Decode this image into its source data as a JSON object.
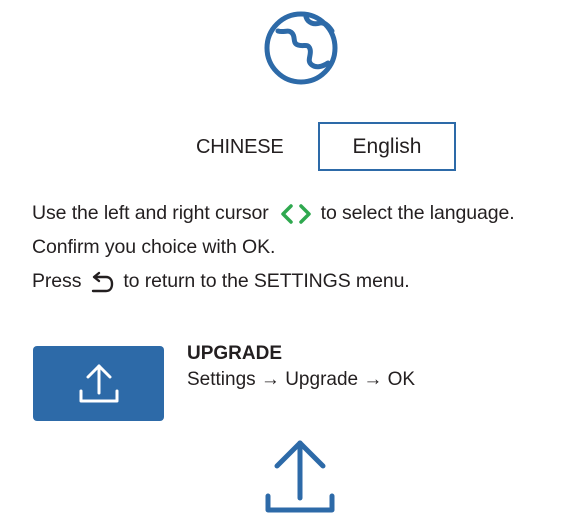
{
  "icons": {
    "globe": "globe-icon",
    "cursor": "left-right-cursor-icon",
    "return": "return-arrow-icon",
    "upgrade": "upload-icon",
    "upload_large": "upload-icon"
  },
  "colors": {
    "accent": "#2d6aa8",
    "cursor_green": "#2fa84f",
    "text": "#231f20"
  },
  "language": {
    "options": [
      "CHINESE",
      "English"
    ],
    "selected": "English"
  },
  "instructions": {
    "line1_before": "Use the left and right cursor",
    "line1_after": "to select the language.",
    "line2": "Confirm you choice with OK.",
    "line3_before": "Press",
    "line3_after": "to return to the SETTINGS menu."
  },
  "upgrade": {
    "title": "UPGRADE",
    "path": "Settings → Upgrade → OK"
  }
}
